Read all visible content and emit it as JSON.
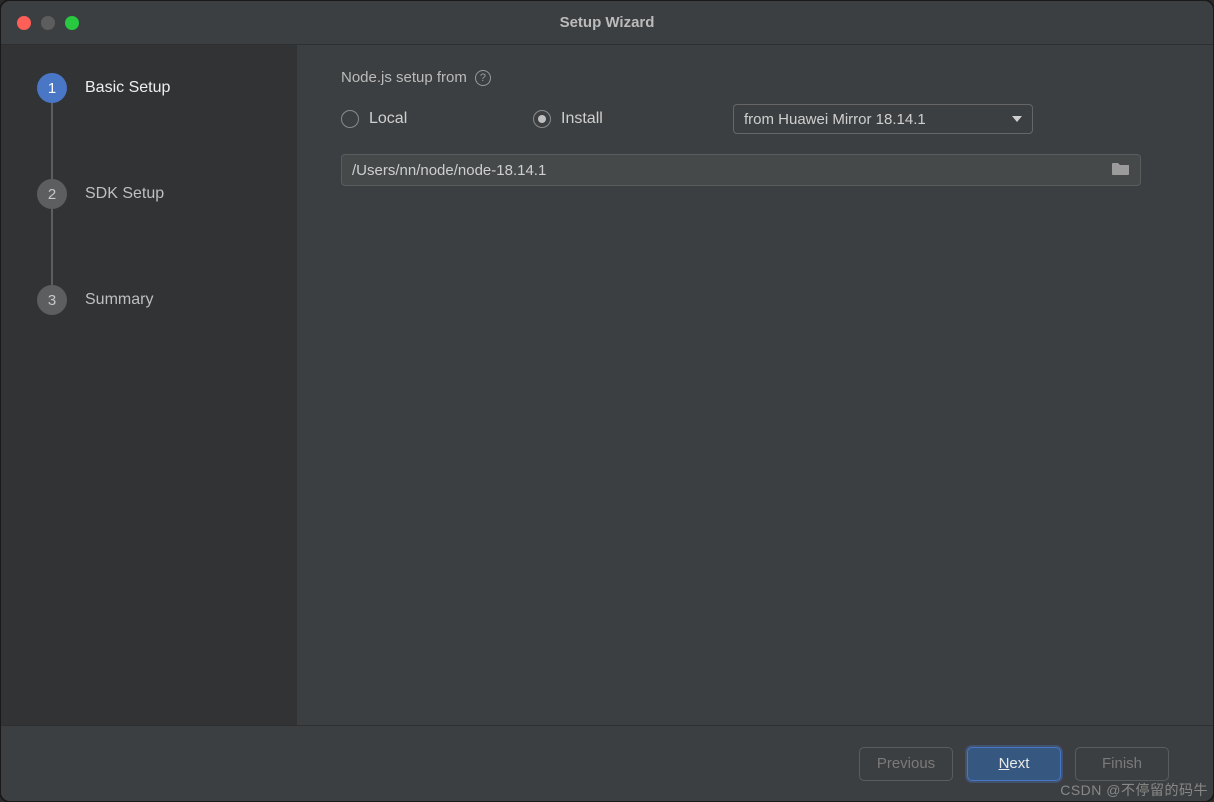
{
  "window": {
    "title": "Setup Wizard"
  },
  "sidebar": {
    "steps": [
      {
        "num": "1",
        "label": "Basic Setup",
        "active": true
      },
      {
        "num": "2",
        "label": "SDK Setup",
        "active": false
      },
      {
        "num": "3",
        "label": "Summary",
        "active": false
      }
    ]
  },
  "main": {
    "section_label": "Node.js setup from",
    "radios": {
      "local": "Local",
      "install": "Install",
      "selected": "install"
    },
    "mirror_select": "from Huawei Mirror 18.14.1",
    "path_value": "/Users/nn/node/node-18.14.1"
  },
  "footer": {
    "previous": "Previous",
    "next_letter": "N",
    "next_rest": "ext",
    "finish": "Finish"
  },
  "watermark": "CSDN @不停留的码牛"
}
